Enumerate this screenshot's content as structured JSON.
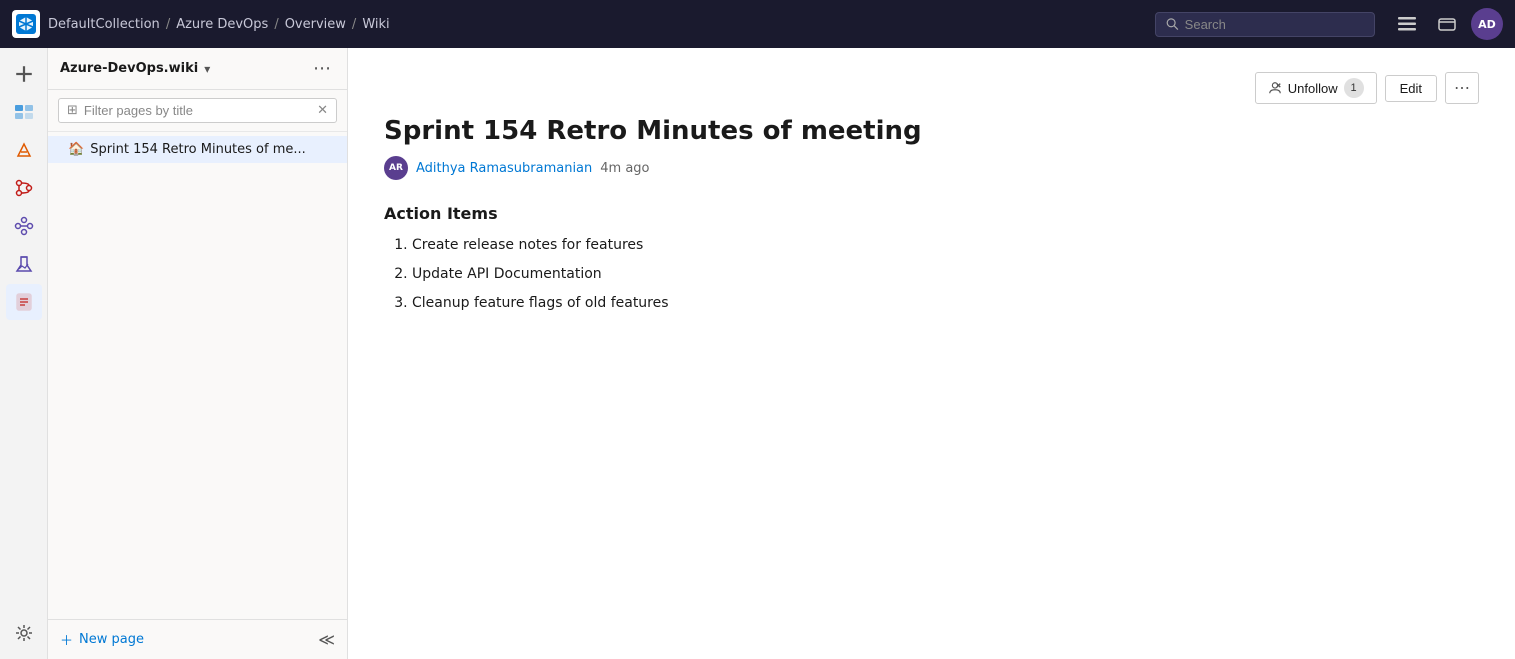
{
  "topbar": {
    "logo_text": "AD",
    "breadcrumb": [
      {
        "label": "DefaultCollection"
      },
      {
        "label": "Azure DevOps"
      },
      {
        "label": "Overview"
      },
      {
        "label": "Wiki"
      }
    ],
    "search_placeholder": "Search",
    "user_initials": "AD"
  },
  "nav_icons": [
    {
      "name": "add-icon",
      "symbol": "＋"
    },
    {
      "name": "boards-icon",
      "symbol": "⊞"
    },
    {
      "name": "sprints-icon",
      "symbol": "⚡"
    },
    {
      "name": "repos-icon",
      "symbol": "⎇"
    },
    {
      "name": "pipelines-icon",
      "symbol": "⟳"
    },
    {
      "name": "test-icon",
      "symbol": "🧪"
    },
    {
      "name": "artifacts-icon",
      "symbol": "📦"
    }
  ],
  "wiki_sidebar": {
    "title": "Azure-DevOps.wiki",
    "filter_placeholder": "Filter pages by title",
    "pages": [
      {
        "label": "Sprint 154 Retro Minutes of me...",
        "icon": "🏠"
      }
    ],
    "new_page_label": "New page"
  },
  "content": {
    "page_title": "Sprint 154 Retro Minutes of meeting",
    "author_initials": "AR",
    "author_name": "Adithya Ramasubramanian",
    "time_ago": "4m ago",
    "unfollow_label": "Unfollow",
    "follow_count": "1",
    "edit_label": "Edit",
    "section_title": "Action Items",
    "action_items": [
      "Create release notes for features",
      "Update API Documentation",
      "Cleanup feature flags of old features"
    ]
  },
  "settings_icon": {
    "symbol": "⚙"
  },
  "collapse_icon": {
    "symbol": "≪"
  }
}
